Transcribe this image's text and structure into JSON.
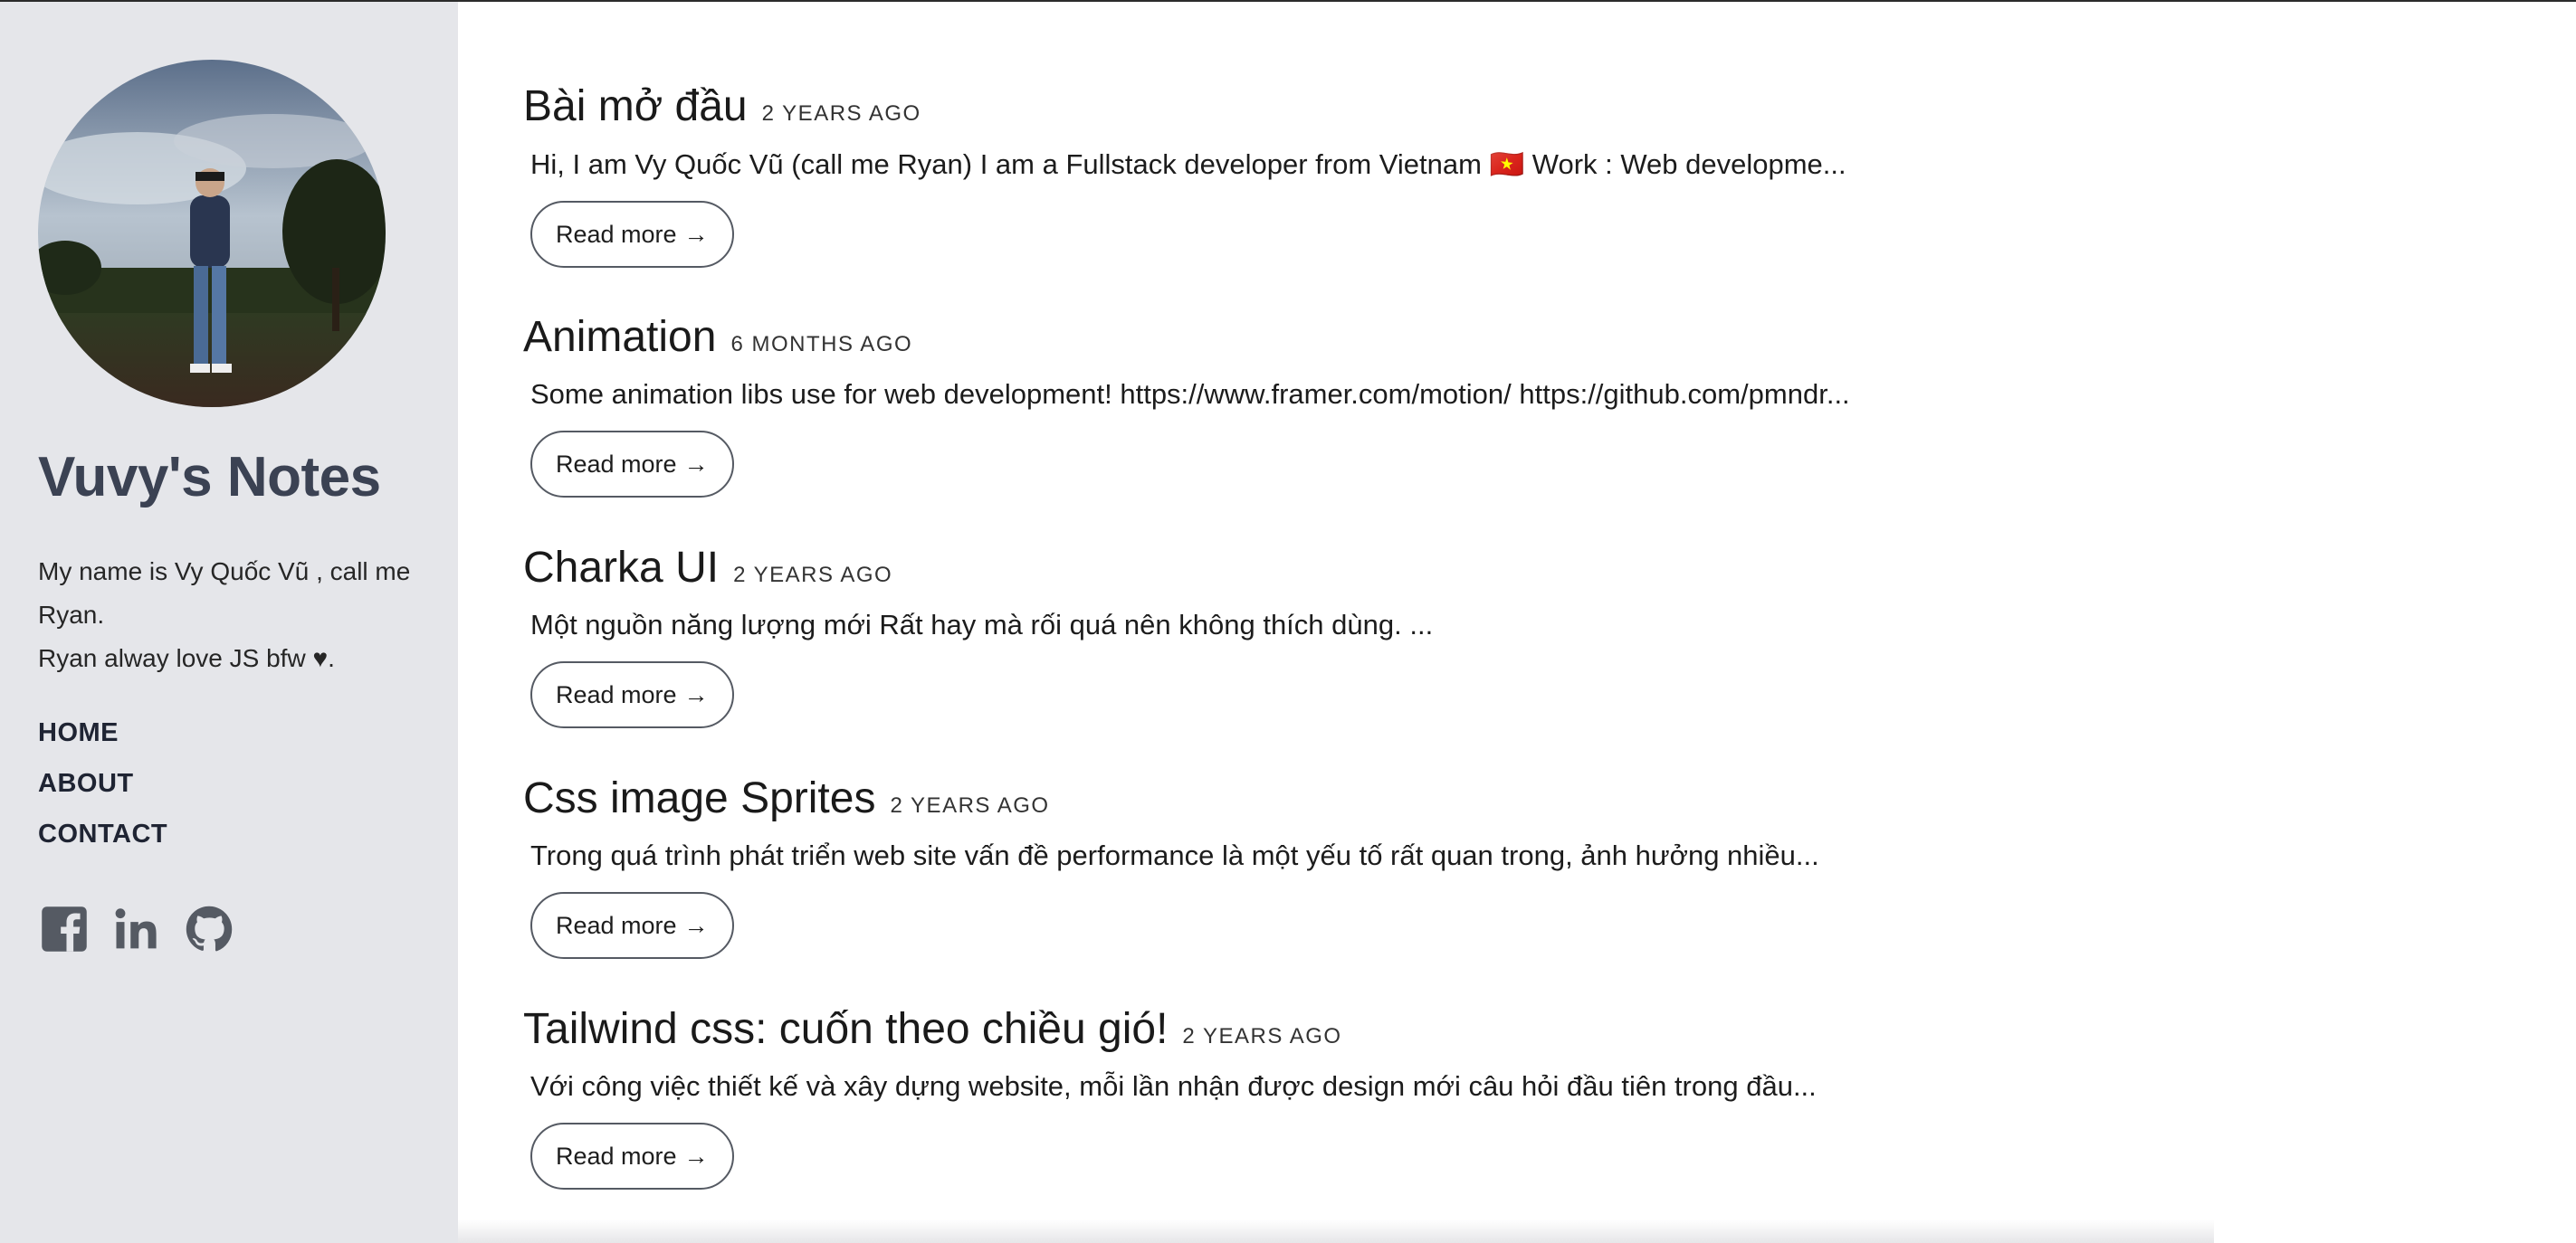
{
  "sidebar": {
    "site_title": "Vuvy's Notes",
    "bio_line1": "My name is Vy Quốc Vũ , call me Ryan.",
    "bio_line2": "Ryan alway love JS bfw ♥.",
    "nav": [
      {
        "label": "HOME"
      },
      {
        "label": "ABOUT"
      },
      {
        "label": "CONTACT"
      }
    ],
    "socials": [
      "facebook-icon",
      "linkedin-icon",
      "github-icon"
    ]
  },
  "posts": [
    {
      "title": "Bài mở đầu",
      "date": "2 YEARS AGO",
      "excerpt": "Hi, I am Vy Quốc Vũ (call me Ryan) I am a Fullstack developer from Vietnam 🇻🇳 Work : Web developme...",
      "read_more": "Read more",
      "arrow": "→"
    },
    {
      "title": "Animation",
      "date": "6 MONTHS AGO",
      "excerpt": "Some animation libs use for web development! https://www.framer.com/motion/ https://github.com/pmndr...",
      "read_more": "Read more",
      "arrow": "→"
    },
    {
      "title": "Charka UI",
      "date": "2 YEARS AGO",
      "excerpt": "Một nguồn năng lượng mới Rất hay mà rối quá nên không thích dùng. ...",
      "read_more": "Read more",
      "arrow": "→"
    },
    {
      "title": "Css image Sprites",
      "date": "2 YEARS AGO",
      "excerpt": "Trong quá trình phát triển web site vấn đề performance là một yếu tố rất quan trong, ảnh hưởng nhiều...",
      "read_more": "Read more",
      "arrow": "→"
    },
    {
      "title": "Tailwind css: cuốn theo chiều gió!",
      "date": "2 YEARS AGO",
      "excerpt": "Với công việc thiết kế và xây dựng website, mỗi lần nhận được design mới câu hỏi đầu tiên trong đầu...",
      "read_more": "Read more",
      "arrow": "→"
    }
  ],
  "colors": {
    "sidebar_bg": "#e5e6ea",
    "title_color": "#3b4253",
    "nav_color": "#1f2433",
    "icon_color": "#555a63"
  }
}
